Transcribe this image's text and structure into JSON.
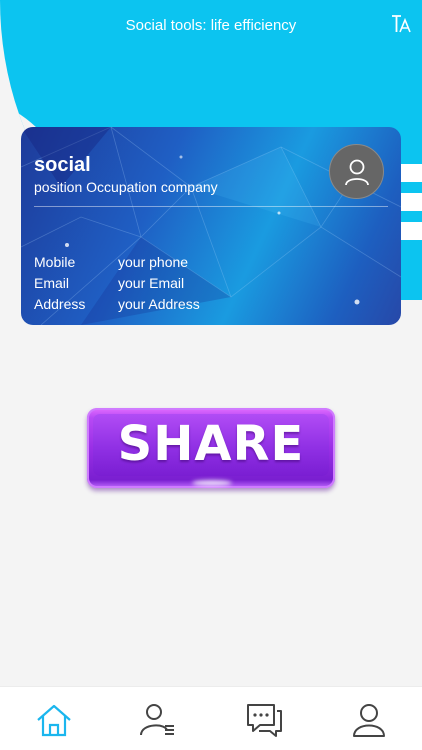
{
  "header": {
    "title": "Social tools: life efficiency",
    "font_icon": "text-size-icon"
  },
  "card": {
    "name": "social",
    "subtitle": "position Occupation company",
    "avatar_icon": "person-icon",
    "rows": [
      {
        "label": "Mobile",
        "value": "your phone"
      },
      {
        "label": "Email",
        "value": "your Email"
      },
      {
        "label": "Address",
        "value": "your Address"
      }
    ]
  },
  "share_button": {
    "label": "SHARE"
  },
  "tabbar": {
    "items": [
      {
        "icon": "home-icon",
        "active": true
      },
      {
        "icon": "contacts-icon",
        "active": false
      },
      {
        "icon": "chat-icon",
        "active": false
      },
      {
        "icon": "profile-icon",
        "active": false
      }
    ]
  },
  "colors": {
    "accent": "#0cc4f0",
    "share": "#9a2fe6",
    "tab_active": "#1bb6ee",
    "tab_inactive": "#444444"
  }
}
